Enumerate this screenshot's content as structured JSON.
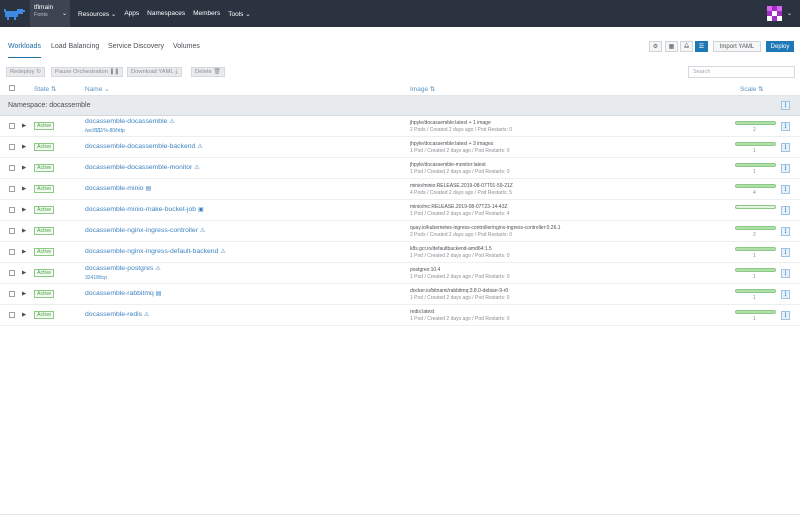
{
  "header": {
    "cluster_name": "tflmain",
    "project_name": "Fonts",
    "nav": [
      "Resources",
      "Apps",
      "Namespaces",
      "Members",
      "Tools"
    ],
    "brand_color": "#2c3340"
  },
  "tabs": [
    "Workloads",
    "Load Balancing",
    "Service Discovery",
    "Volumes"
  ],
  "actions": {
    "import_label": "Import YAML",
    "deploy_label": "Deploy"
  },
  "bulk": {
    "redeploy": "Redeploy",
    "pause": "Pause Orchestration",
    "download": "Download YAML",
    "delete": "Delete",
    "search_placeholder": "Search"
  },
  "columns": {
    "state": "State",
    "name": "Name",
    "image": "Image",
    "scale": "Scale"
  },
  "namespace_label": "Namespace: docassemble",
  "workloads": [
    {
      "state": "Active",
      "name": "docassemble-docassemble",
      "name_icon": "lock-icon",
      "sub": "/wcl/$$1%-80/http",
      "image": "jhpyle/docassemble:latest + 1 image",
      "meta": "2 Pods / Created 2 days ago / Pod Restarts: 0",
      "scale": "2",
      "scale_fraction": 1
    },
    {
      "state": "Active",
      "name": "docassemble-docassemble-backend",
      "name_icon": "lock-icon",
      "sub": "",
      "image": "jhpyle/docassemble:latest + 3 images",
      "meta": "1 Pod / Created 2 days ago / Pod Restarts: 0",
      "scale": "1",
      "scale_fraction": 1
    },
    {
      "state": "Active",
      "name": "docassemble-docassemble-monitor",
      "name_icon": "lock-icon",
      "sub": "",
      "image": "jhpyle/docassemble-monitor:latest",
      "meta": "1 Pod / Created 2 days ago / Pod Restarts: 0",
      "scale": "1",
      "scale_fraction": 1
    },
    {
      "state": "Active",
      "name": "docassemble-minio",
      "name_icon": "list-icon",
      "sub": "",
      "image": "minio/minio:RELEASE.2019-08-07T01-59-21Z",
      "meta": "4 Pods / Created 2 days ago / Pod Restarts: 5",
      "scale": "4",
      "scale_fraction": 1
    },
    {
      "state": "Active",
      "name": "docassemble-minio-make-bucket-job",
      "name_icon": "doc-icon",
      "sub": "",
      "image": "minio/mc:RELEASE.2019-08-07T23-14-43Z",
      "meta": "1 Pod / Created 2 days ago / Pod Restarts: 4",
      "scale": "",
      "scale_fraction": 0
    },
    {
      "state": "Active",
      "name": "docassemble-nginx-ingress-controller",
      "name_icon": "lock-icon",
      "sub": "",
      "image": "quay.io/kubernetes-ingress-controller/nginx-ingress-controller:0.26.1",
      "meta": "2 Pods / Created 2 days ago / Pod Restarts: 0",
      "scale": "2",
      "scale_fraction": 1
    },
    {
      "state": "Active",
      "name": "docassemble-nginx-ingress-default-backend",
      "name_icon": "lock-icon",
      "sub": "",
      "image": "k8s.gcr.io/defaultbackend-amd64:1.5",
      "meta": "1 Pod / Created 2 days ago / Pod Restarts: 0",
      "scale": "1",
      "scale_fraction": 1
    },
    {
      "state": "Active",
      "name": "docassemble-postgres",
      "name_icon": "lock-icon",
      "sub": "32418/tcp",
      "image": "postgres:10.4",
      "meta": "1 Pod / Created 2 days ago / Pod Restarts: 0",
      "scale": "1",
      "scale_fraction": 1
    },
    {
      "state": "Active",
      "name": "docassemble-rabbitmq",
      "name_icon": "list-icon",
      "sub": "",
      "image": "docker.io/bitnami/rabbitmq:3.8.0-debian-9-r0",
      "meta": "1 Pod / Created 2 days ago / Pod Restarts: 0",
      "scale": "1",
      "scale_fraction": 1
    },
    {
      "state": "Active",
      "name": "docassemble-redis",
      "name_icon": "lock-icon",
      "sub": "",
      "image": "redis:latest",
      "meta": "1 Pod / Created 2 days ago / Pod Restarts: 0",
      "scale": "1",
      "scale_fraction": 1
    }
  ]
}
